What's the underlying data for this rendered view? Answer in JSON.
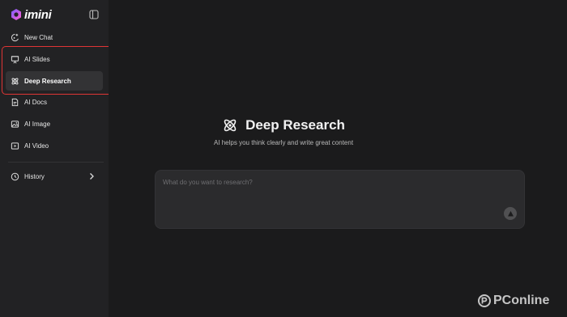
{
  "app": {
    "brand": "imini"
  },
  "sidebar": {
    "items": [
      {
        "label": "New Chat",
        "icon": "new-chat-icon"
      },
      {
        "label": "AI Slides",
        "icon": "slides-icon"
      },
      {
        "label": "Deep Research",
        "icon": "atom-icon",
        "active": true
      },
      {
        "label": "AI Docs",
        "icon": "docs-icon"
      },
      {
        "label": "AI Image",
        "icon": "image-icon"
      },
      {
        "label": "AI Video",
        "icon": "video-icon"
      }
    ],
    "history_label": "History"
  },
  "main": {
    "title": "Deep Research",
    "subtitle": "AI helps you think clearly and write great content",
    "input_placeholder": "What do you want to research?"
  },
  "watermark": "PConline",
  "colors": {
    "background": "#1b1b1c",
    "sidebar": "#222224",
    "active_item": "#333335",
    "highlight": "#e03535",
    "brand_gradient_start": "#7b5cff",
    "brand_gradient_end": "#ff5fd2"
  }
}
